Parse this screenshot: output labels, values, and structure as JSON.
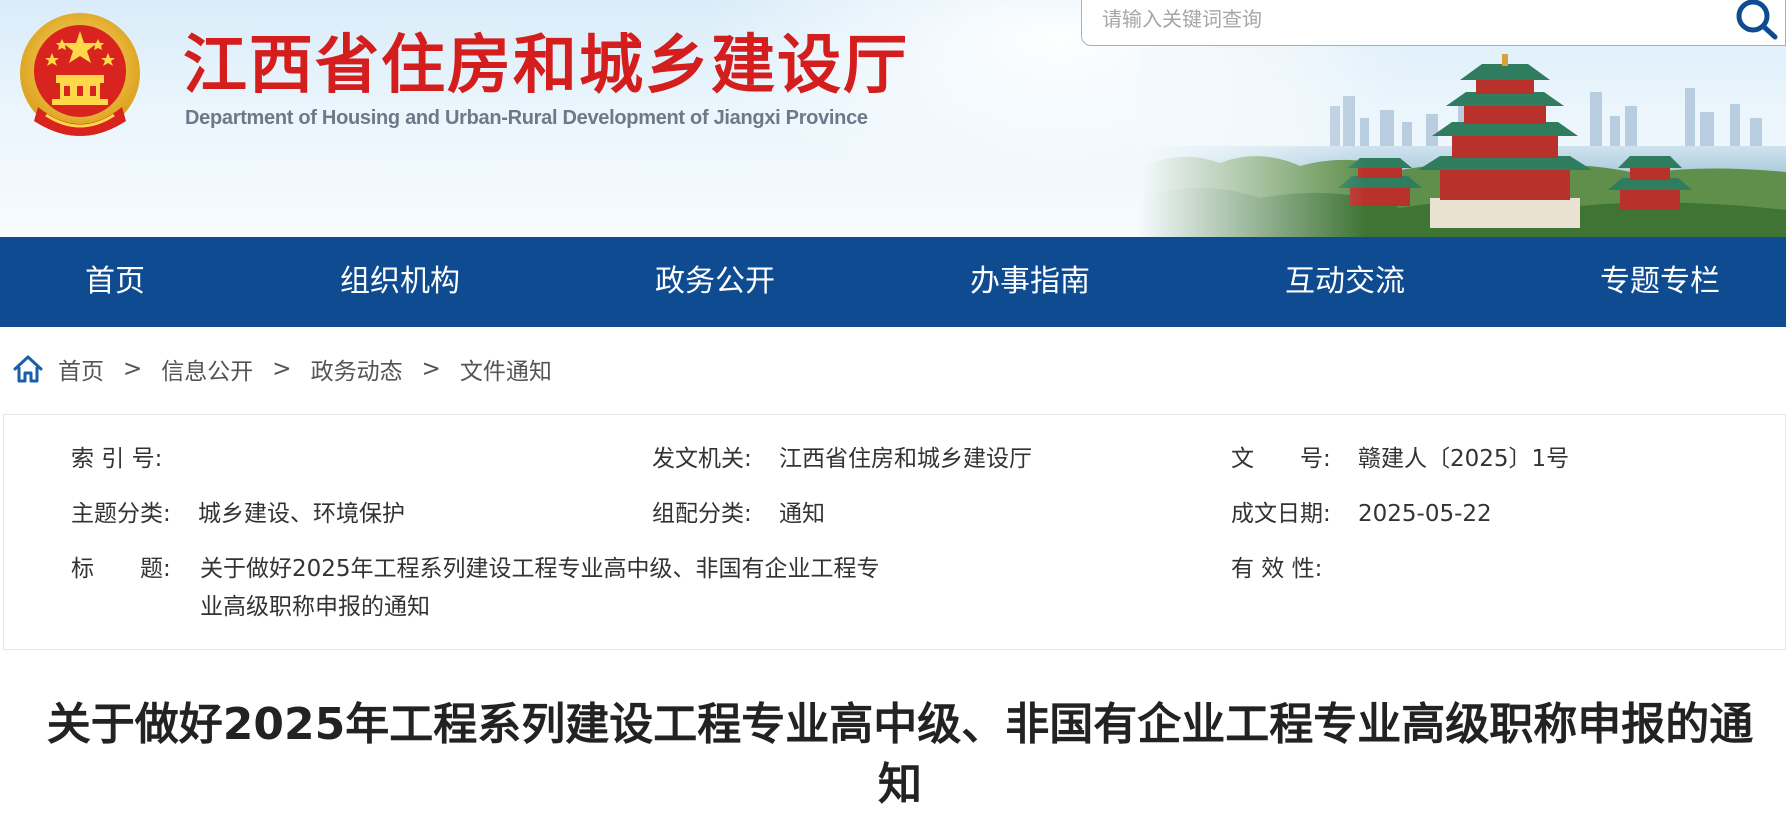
{
  "header": {
    "title": "江西省住房和城乡建设厅",
    "subtitle": "Department of Housing and Urban-Rural Development of Jiangxi Province",
    "emblem_icon": "national-emblem-icon",
    "search": {
      "placeholder": "请输入关键词查询",
      "icon": "search-icon"
    }
  },
  "nav": {
    "items": [
      {
        "label": "首页"
      },
      {
        "label": "组织机构"
      },
      {
        "label": "政务公开"
      },
      {
        "label": "办事指南"
      },
      {
        "label": "互动交流"
      },
      {
        "label": "专题专栏"
      }
    ]
  },
  "breadcrumb": {
    "icon": "home-icon",
    "separator": ">",
    "items": [
      "首页",
      "信息公开",
      "政务动态",
      "文件通知"
    ]
  },
  "info": {
    "index_no": {
      "label": "索 引 号:",
      "value": ""
    },
    "issuer": {
      "label": "发文机关:",
      "value": "江西省住房和城乡建设厅"
    },
    "doc_no": {
      "label": "文　　号:",
      "value": "赣建人〔2025〕1号"
    },
    "topic": {
      "label": "主题分类:",
      "value": "城乡建设、环境保护"
    },
    "category": {
      "label": "组配分类:",
      "value": "通知"
    },
    "date": {
      "label": "成文日期:",
      "value": "2025-05-22"
    },
    "title": {
      "label": "标　　题:",
      "value": "关于做好2025年工程系列建设工程专业高中级、非国有企业工程专业高级职称申报的通知"
    },
    "validity": {
      "label": "有 效 性:",
      "value": ""
    }
  },
  "article": {
    "title": "关于做好2025年工程系列建设工程专业高中级、非国有企业工程专业高级职称申报的通知"
  },
  "colors": {
    "nav_bg": "#0e4b90",
    "title_red": "#d41d1d",
    "text": "#333333"
  }
}
